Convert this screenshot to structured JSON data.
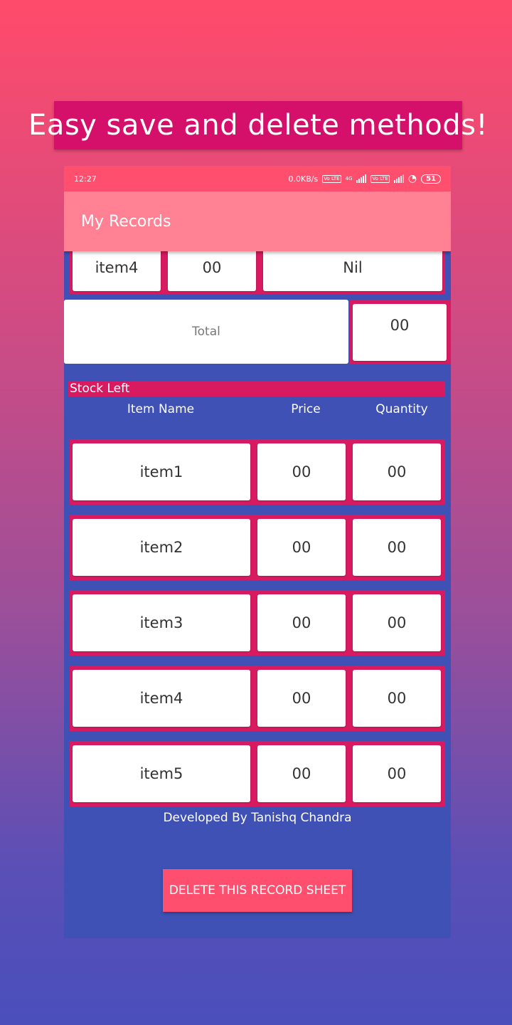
{
  "banner": {
    "text": "Easy save and delete methods!"
  },
  "status_bar": {
    "time": "12:27",
    "speed": "0.0KB/s",
    "network_type": "4G",
    "lte_label": "Vo LTE",
    "battery": "51"
  },
  "app_bar": {
    "title": "My Records"
  },
  "sold_partial_row": {
    "item": "item4",
    "price": "00",
    "buyer": "Nil"
  },
  "total": {
    "label": "Total",
    "value": "00"
  },
  "stock_left": {
    "title": "Stock Left",
    "headers": [
      "Item Name",
      "Price",
      "Quantity"
    ],
    "rows": [
      {
        "name": "item1",
        "price": "00",
        "quantity": "00"
      },
      {
        "name": "item2",
        "price": "00",
        "quantity": "00"
      },
      {
        "name": "item3",
        "price": "00",
        "quantity": "00"
      },
      {
        "name": "item4",
        "price": "00",
        "quantity": "00"
      },
      {
        "name": "item5",
        "price": "00",
        "quantity": "00"
      }
    ]
  },
  "footer": {
    "credit": "Developed By Tanishq Chandra"
  },
  "actions": {
    "delete_label": "DELETE THIS RECORD SHEET"
  },
  "colors": {
    "accent": "#d81b60",
    "background": "#3f51b5",
    "appbar": "#ff8193",
    "statusbar": "#ff4f6e"
  }
}
